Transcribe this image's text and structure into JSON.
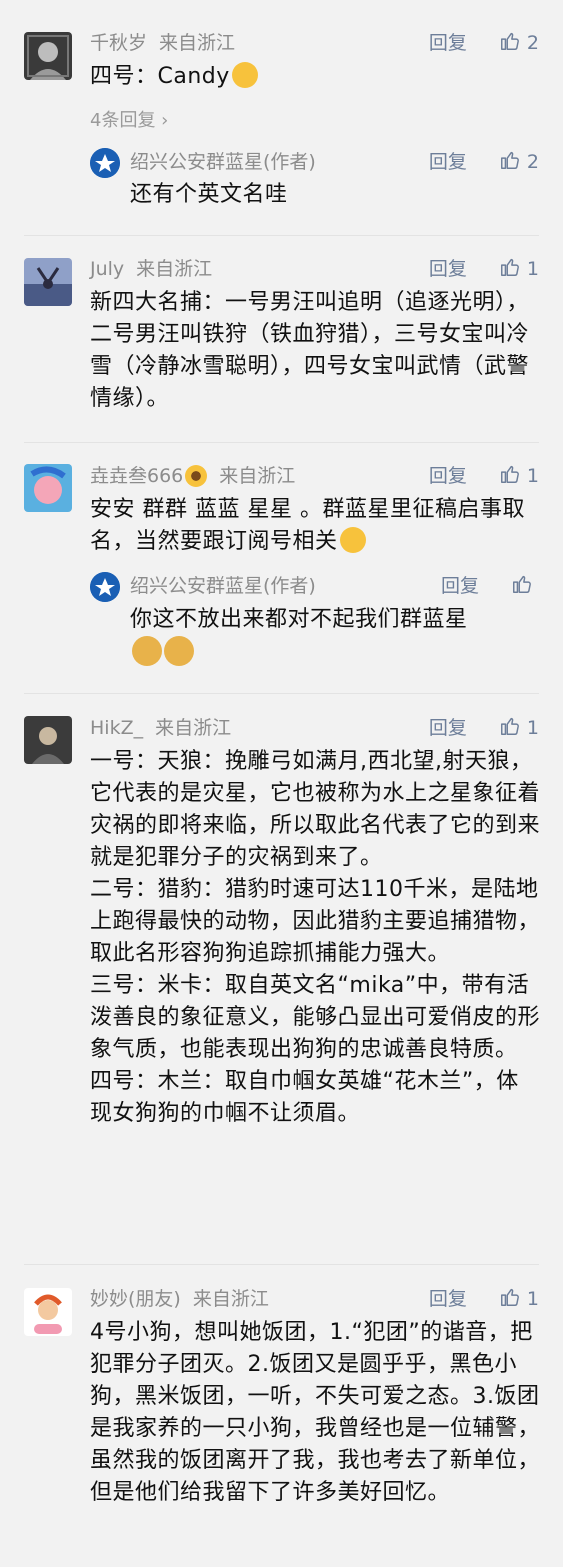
{
  "comments": [
    {
      "name": "千秋岁",
      "location": "来自浙江",
      "reply_label": "回复",
      "likes": "2",
      "text": "四号：Candy",
      "emoji": "thinking-face",
      "more_replies": "4条回复",
      "reply": {
        "name": "绍兴公安群蓝星(作者)",
        "reply_label": "回复",
        "likes": "2",
        "text": "还有个英文名哇"
      }
    },
    {
      "name": "July",
      "location": "来自浙江",
      "reply_label": "回复",
      "likes": "1",
      "text": "新四大名捕：一号男汪叫追明（追逐光明），二号男汪叫铁狩（铁血狩猎），三号女宝叫冷雪（冷静冰雪聪明），四号女宝叫武情（武警情缘）。"
    },
    {
      "name": "垚垚叁666",
      "name_emoji": "sunflower",
      "location": "来自浙江",
      "reply_label": "回复",
      "likes": "1",
      "text": "安安 群群 蓝蓝 星星 。群蓝星里征稿启事取名，当然要跟订阅号相关",
      "emoji": "grinning-face",
      "reply": {
        "name": "绍兴公安群蓝星(作者)",
        "reply_label": "回复",
        "likes": "",
        "text": "你这不放出来都对不起我们群蓝星",
        "emoji": "doge-faces"
      }
    },
    {
      "name": "HikZ_",
      "location": "来自浙江",
      "reply_label": "回复",
      "likes": "1",
      "paragraphs": [
        "一号：天狼：挽雕弓如满月,西北望,射天狼，它代表的是灾星，它也被称为水上之星象征着灾祸的即将来临，所以取此名代表了它的到来就是犯罪分子的灾祸到来了。",
        "二号：猎豹：猎豹时速可达110千米，是陆地上跑得最快的动物，因此猎豹主要追捕猎物，取此名形容狗狗追踪抓捕能力强大。",
        "三号：米卡：取自英文名“mika”中，带有活泼善良的象征意义，能够凸显出可爱俏皮的形象气质，也能表现出狗狗的忠诚善良特质。",
        "四号：木兰：取自巾帼女英雄“花木兰”，体现女狗狗的巾帼不让须眉。"
      ]
    },
    {
      "name": "妙妙(朋友)",
      "location": "来自浙江",
      "reply_label": "回复",
      "likes": "1",
      "text": "4号小狗，想叫她饭团，1.“犯团”的谐音，把犯罪分子团灭。2.饭团又是圆乎乎，黑色小狗，黑米饭团，一听，不失可爱之态。3.饭团是我家养的一只小狗，我曾经也是一位辅警，虽然我的饭团离开了我，我也考去了新单位，但是他们给我留下了许多美好回忆。"
    }
  ],
  "colors": {
    "background": "#f2f2f2",
    "meta": "#8c8c8c",
    "action": "#6d7e99",
    "text": "#111111"
  }
}
